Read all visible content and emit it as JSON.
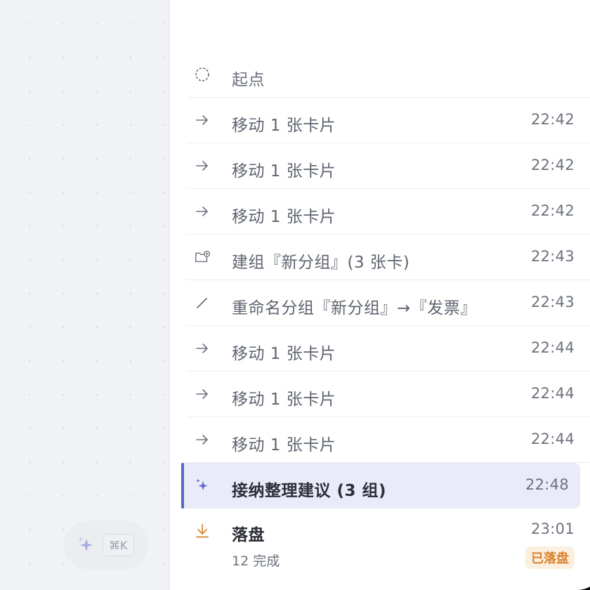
{
  "canvas": {
    "ai_shortcut": {
      "icon": "sparkles-icon",
      "key_hint": "⌘K"
    }
  },
  "history": {
    "items": [
      {
        "icon": "circle-dashed-icon",
        "label": "起点",
        "time": ""
      },
      {
        "icon": "arrow-right-icon",
        "label": "移动 1 张卡片",
        "time": "22:42"
      },
      {
        "icon": "arrow-right-icon",
        "label": "移动 1 张卡片",
        "time": "22:42"
      },
      {
        "icon": "arrow-right-icon",
        "label": "移动 1 张卡片",
        "time": "22:42"
      },
      {
        "icon": "folder-plus-icon",
        "label": "建组『新分组』(3 张卡)",
        "time": "22:43"
      },
      {
        "icon": "pencil-icon",
        "label": "重命名分组『新分组』→『发票』",
        "time": "22:43"
      },
      {
        "icon": "arrow-right-icon",
        "label": "移动 1 张卡片",
        "time": "22:44"
      },
      {
        "icon": "arrow-right-icon",
        "label": "移动 1 张卡片",
        "time": "22:44"
      },
      {
        "icon": "arrow-right-icon",
        "label": "移动 1 张卡片",
        "time": "22:44"
      },
      {
        "icon": "sparkles-icon",
        "label": "接纳整理建议 (3 组)",
        "time": "22:48",
        "active": true
      },
      {
        "icon": "download-arrow-icon",
        "label": "落盘",
        "time": "23:01",
        "sub": "12 完成",
        "badge": "已落盘"
      }
    ]
  },
  "colors": {
    "accent": "#5b67c7",
    "highlight_bg": "#e9ecf8",
    "save_orange": "#d9822b",
    "badge_bg": "#fbefe0"
  }
}
